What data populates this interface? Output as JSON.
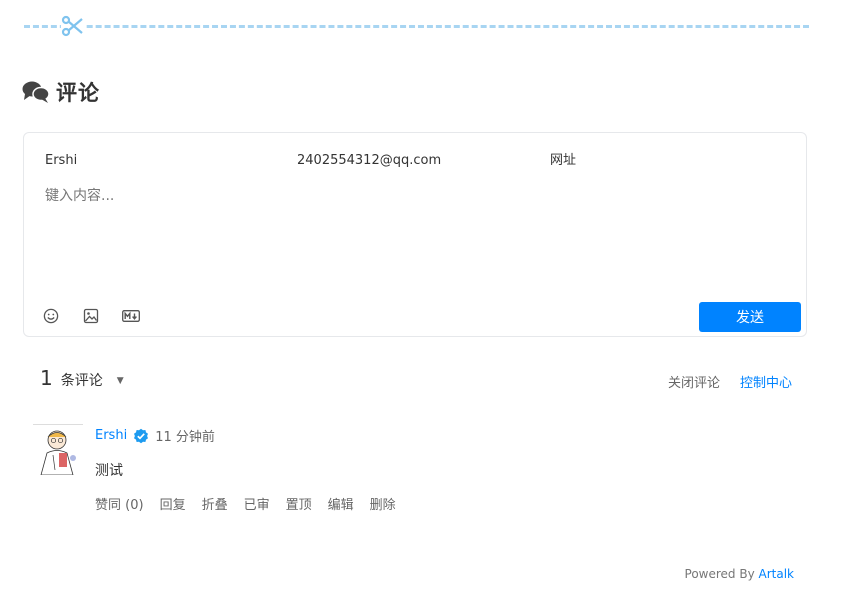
{
  "section": {
    "title": "评论"
  },
  "editor": {
    "nick_placeholder": "Ershi",
    "email_placeholder": "2402554312@qq.com",
    "link_placeholder": "网址",
    "content_placeholder": "键入内容...",
    "send_label": "发送",
    "tools": [
      "emoji-icon",
      "image-icon",
      "markdown-icon"
    ]
  },
  "list": {
    "count": "1",
    "count_label": "条评论",
    "caret": "▼",
    "close_label": "关闭评论",
    "admin_label": "控制中心"
  },
  "comments": [
    {
      "name": "Ershi",
      "time": "11 分钟前",
      "content": "测试",
      "actions": {
        "vote": "赞同 (0)",
        "reply": "回复",
        "collapse": "折叠",
        "approved": "已审",
        "pin": "置顶",
        "edit": "编辑",
        "delete": "删除"
      }
    }
  ],
  "footer": {
    "powered_by": "Powered By",
    "brand": "Artalk"
  },
  "colors": {
    "accent": "#0083ff",
    "divider": "#a8d5f2",
    "text": "#333333",
    "muted": "#666666"
  }
}
